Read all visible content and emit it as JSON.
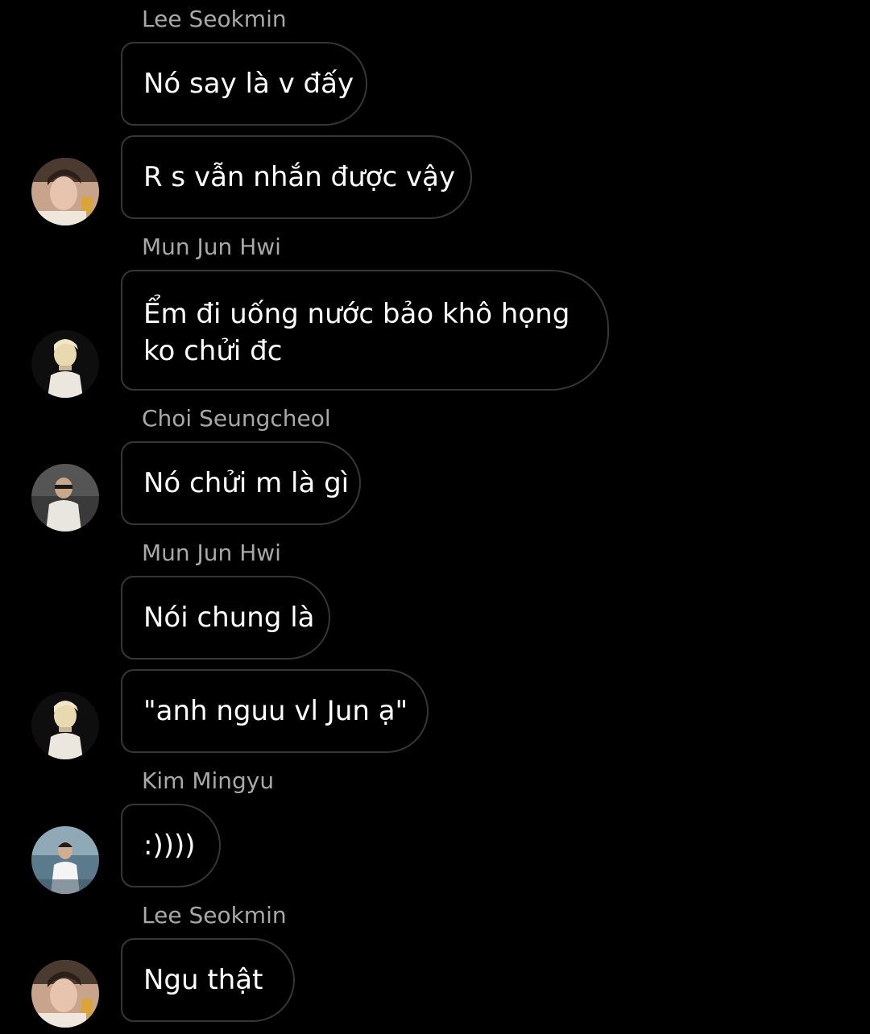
{
  "messages": [
    {
      "sender": "Lee Seokmin",
      "text": "Nó say là v đấy"
    },
    {
      "sender": "",
      "text": "R s vẫn nhắn được vậy",
      "avatar": "avatar-lee-seokmin"
    },
    {
      "sender": "Mun Jun Hwi",
      "text_lines": [
        "Ểm đi uống nước bảo khô họng",
        "ko chửi đc"
      ],
      "avatar": "avatar-mun-jun-hwi"
    },
    {
      "sender": "Choi Seungcheol",
      "text": "Nó chửi m là gì",
      "avatar": "avatar-choi-seungcheol"
    },
    {
      "sender": "Mun Jun Hwi",
      "text": "Nói chung là"
    },
    {
      "sender": "",
      "text": "\"anh nguu vl Jun ạ\"",
      "avatar": "avatar-mun-jun-hwi"
    },
    {
      "sender": "Kim Mingyu",
      "text": ":))))",
      "avatar": "avatar-kim-mingyu"
    },
    {
      "sender": "Lee Seokmin",
      "text": "Ngu thật",
      "avatar": "avatar-lee-seokmin"
    }
  ],
  "colors": {
    "background": "#000000",
    "bubble_border": "#363636",
    "sender_name": "#a8a8a8",
    "message_text": "#ffffff"
  }
}
